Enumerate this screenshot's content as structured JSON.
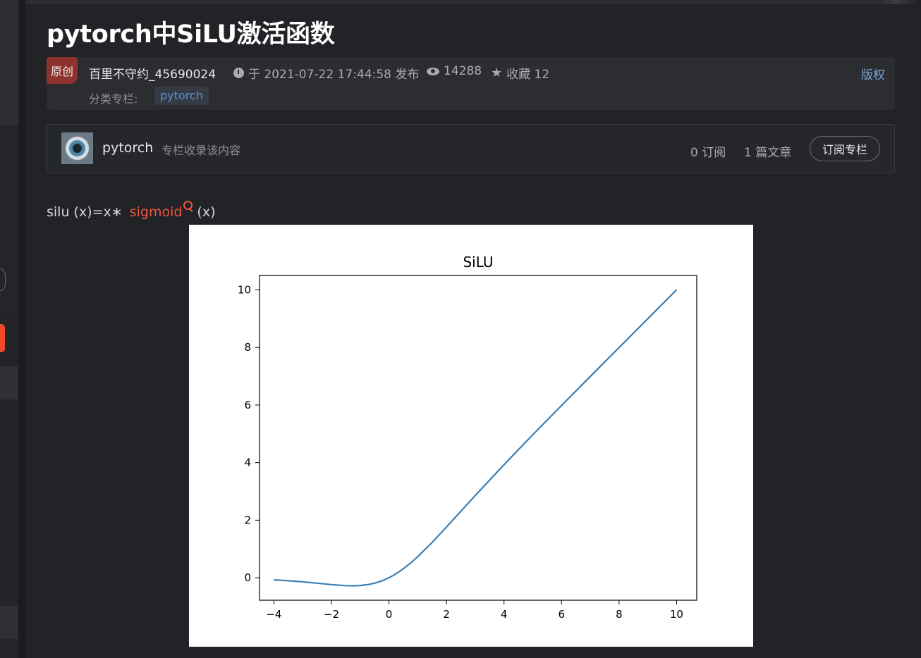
{
  "article": {
    "title": "pytorch中SiLU激活函数",
    "badge": "原创",
    "author": "百里不守约_45690024",
    "published": "于 2021-07-22 17:44:58 发布",
    "views": "14288",
    "favorites": "收藏 12",
    "copyright": "版权",
    "category_label": "分类专栏:",
    "category_tag": "pytorch"
  },
  "column": {
    "name": "pytorch",
    "description": "专栏收录该内容",
    "subscribers": "0 订阅",
    "article_count": "1 篇文章",
    "subscribe_button": "订阅专栏"
  },
  "formula": {
    "prefix": "silu (x)=x∗",
    "link": "sigmoid",
    "suffix": "(x)"
  },
  "chart_data": {
    "type": "line",
    "title": "SiLU",
    "xlabel": "",
    "ylabel": "",
    "xlim": [
      -4.5,
      10.7
    ],
    "ylim": [
      -0.78,
      10.5
    ],
    "xticks": [
      -4,
      -2,
      0,
      2,
      4,
      6,
      8,
      10
    ],
    "xtick_labels": [
      "−4",
      "−2",
      "0",
      "2",
      "4",
      "6",
      "8",
      "10"
    ],
    "yticks": [
      0,
      2,
      4,
      6,
      8,
      10
    ],
    "ytick_labels": [
      "0",
      "2",
      "4",
      "6",
      "8",
      "10"
    ],
    "grid": false,
    "series": [
      {
        "color": "#3a7fb5",
        "x": [
          -4,
          -3.5,
          -3,
          -2.5,
          -2,
          -1.5,
          -1.25,
          -1,
          -0.75,
          -0.5,
          -0.25,
          0,
          0.25,
          0.5,
          0.75,
          1,
          1.5,
          2,
          2.5,
          3,
          4,
          5,
          6,
          7,
          8,
          9,
          10
        ],
        "y": [
          -0.072,
          -0.103,
          -0.142,
          -0.189,
          -0.238,
          -0.274,
          -0.279,
          -0.269,
          -0.24,
          -0.189,
          -0.11,
          0,
          0.14,
          0.311,
          0.51,
          0.731,
          1.227,
          1.762,
          2.311,
          2.857,
          3.928,
          4.967,
          5.985,
          6.994,
          7.997,
          8.999,
          10.0
        ]
      }
    ]
  }
}
